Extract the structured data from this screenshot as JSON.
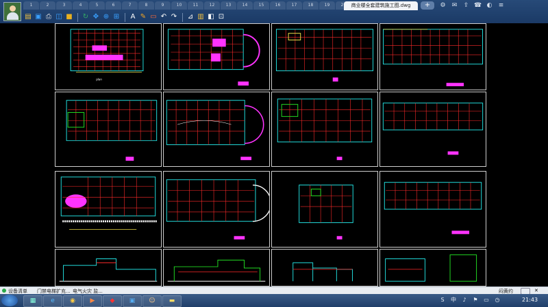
{
  "titlebar": {
    "file_tabs": [
      "1",
      "2",
      "3",
      "4",
      "5",
      "6",
      "7",
      "8",
      "9",
      "10",
      "11",
      "12",
      "13",
      "14",
      "15",
      "16",
      "17",
      "18",
      "19",
      "20"
    ],
    "active_tab": "商业楼全套建筑施工图.dwg",
    "new_tab_symbol": "+",
    "window_icons": [
      "settings-icon",
      "mail-icon",
      "share-icon",
      "phone-icon",
      "skin-icon",
      "menu-icon"
    ]
  },
  "toolbar": {
    "icons": [
      "open-icon",
      "save-icon",
      "print-icon",
      "preview-icon",
      "lock-icon",
      "rotate-icon",
      "pan-icon",
      "zoom-icon",
      "zoom-extents-icon",
      "text-icon",
      "pencil-icon",
      "rectangle-icon",
      "undo-icon",
      "redo-icon",
      "measure-icon",
      "layers-icon",
      "layer-state-icon",
      "insert-icon"
    ]
  },
  "bottom_tabs": {
    "items": [
      "设备清单",
      "门禁电梯扩充...",
      "电气火灾 监..."
    ],
    "right_label": "闷黄约"
  },
  "taskbar": {
    "apps": [
      "explorer",
      "ie",
      "browser",
      "player",
      "cad",
      "viewer",
      "user",
      "folder"
    ],
    "tray": [
      "S",
      "中",
      "♪",
      "⚑",
      "▭",
      "◷"
    ],
    "clock": "21:43"
  },
  "colors": {
    "titlebar": "#1b3a66",
    "drawing_bg": "#000000",
    "cad_white": "#ffffff",
    "cad_red": "#ff2a2a",
    "cad_green": "#22dd22",
    "cad_cyan": "#22dddd",
    "cad_magenta": "#ff33ff",
    "cad_yellow": "#f2e04a"
  }
}
